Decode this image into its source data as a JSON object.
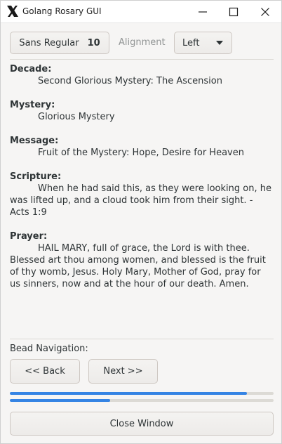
{
  "window": {
    "title": "Golang Rosary GUI",
    "icon": "x-logo-icon"
  },
  "toolbar": {
    "font_name": "Sans Regular",
    "font_size": "10",
    "alignment_label": "Alignment",
    "alignment_value": "Left"
  },
  "content": {
    "decade_label": "Decade:",
    "decade_text": "Second Glorious Mystery: The Ascension",
    "mystery_label": "Mystery:",
    "mystery_text": "Glorious Mystery",
    "message_label": "Message:",
    "message_text": "Fruit of the Mystery: Hope, Desire for Heaven",
    "scripture_label": "Scripture:",
    "scripture_text": "When he had said this, as they were looking on, he was lifted up, and a cloud took him from their sight. - Acts 1:9",
    "prayer_label": "Prayer:",
    "prayer_text": "HAIL MARY, full of grace, the Lord is with thee. Blessed art thou among women, and blessed is the fruit of thy womb, Jesus. Holy Mary, Mother of God, pray for us sinners, now and at the hour of our death. Amen."
  },
  "navigation": {
    "label": "Bead Navigation:",
    "back_label": "<< Back",
    "next_label": "Next >>"
  },
  "progress": {
    "bar1_fraction": 0.9,
    "bar2_fraction": 0.38,
    "fill_color": "#3584e4"
  },
  "footer": {
    "close_label": "Close Window"
  }
}
